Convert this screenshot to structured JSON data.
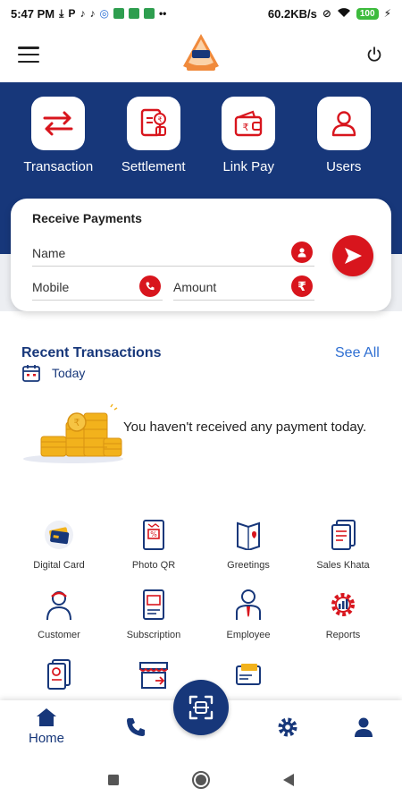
{
  "status_bar": {
    "time": "5:47 PM",
    "network_speed": "60.2KB/s",
    "battery": "100",
    "icons": [
      "download-icon",
      "parking-icon",
      "tiktok-icon",
      "tiktok-icon",
      "browser-icon",
      "app-icon",
      "app-icon",
      "app-icon",
      "more-icon",
      "alarm-off-icon",
      "wifi-icon",
      "battery-icon",
      "charging-icon"
    ]
  },
  "header": {
    "menu_icon": "hamburger-icon",
    "logo_icon": "brand-logo",
    "power_icon": "power-icon"
  },
  "quick_actions": [
    {
      "label": "Transaction",
      "icon": "transfer-arrows-icon"
    },
    {
      "label": "Settlement",
      "icon": "settlement-doc-icon"
    },
    {
      "label": "Link Pay",
      "icon": "wallet-icon"
    },
    {
      "label": "Users",
      "icon": "user-icon"
    }
  ],
  "receive_payments": {
    "title": "Receive Payments",
    "name_placeholder": "Name",
    "mobile_placeholder": "Mobile",
    "amount_placeholder": "Amount"
  },
  "recent_transactions": {
    "title": "Recent Transactions",
    "see_all": "See All",
    "period": "Today",
    "empty_message": "You haven't received any payment today."
  },
  "services": [
    {
      "label": "Digital Card",
      "icon": "credit-card-icon"
    },
    {
      "label": "Photo QR",
      "icon": "photo-qr-icon"
    },
    {
      "label": "Greetings",
      "icon": "greeting-card-icon"
    },
    {
      "label": "Sales Khata",
      "icon": "ledger-icon"
    },
    {
      "label": "Customer",
      "icon": "customer-icon"
    },
    {
      "label": "Subscription",
      "icon": "subscription-icon"
    },
    {
      "label": "Employee",
      "icon": "employee-icon"
    },
    {
      "label": "Reports",
      "icon": "reports-gear-icon"
    },
    {
      "label": "",
      "icon": "document-icon"
    },
    {
      "label": "",
      "icon": "store-icon"
    },
    {
      "label": "",
      "icon": "wallet-card-icon"
    }
  ],
  "bottom_nav": {
    "home_label": "Home",
    "items": [
      "home-icon",
      "phone-icon",
      "scan-icon",
      "settings-icon",
      "profile-icon"
    ]
  },
  "colors": {
    "primary": "#17377a",
    "accent": "#d8151d",
    "link": "#2f6fd2"
  }
}
